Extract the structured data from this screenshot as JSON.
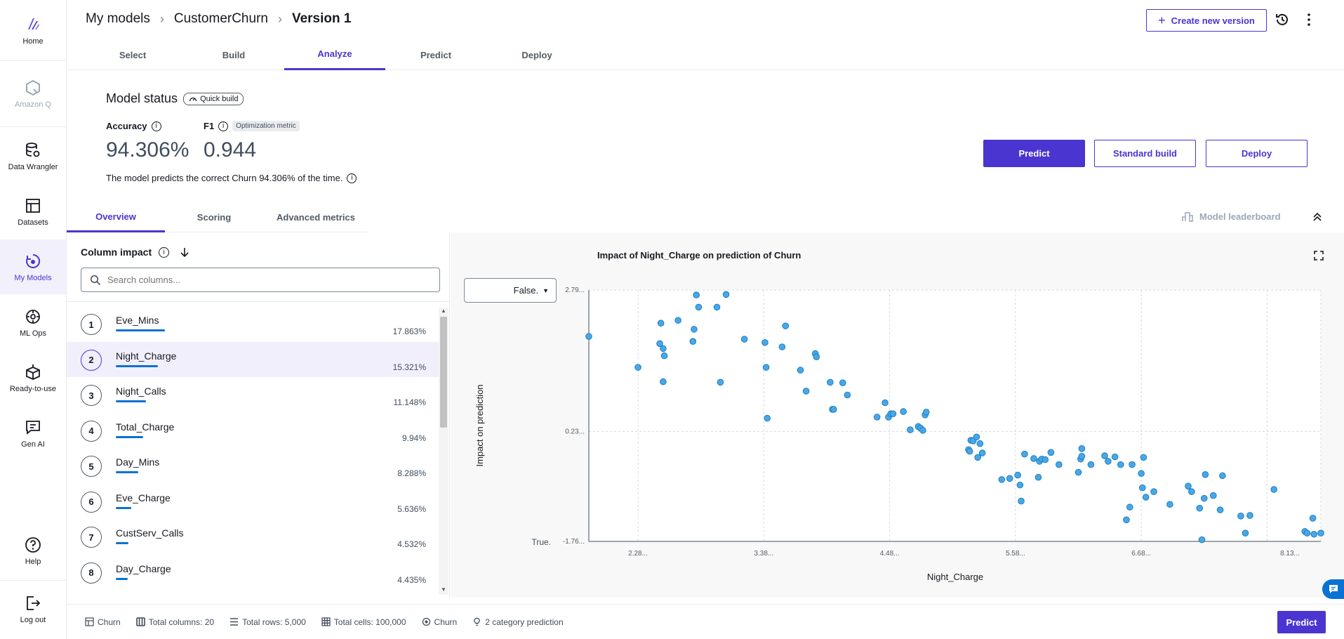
{
  "nav": {
    "home": "Home",
    "amazon_q": "Amazon Q",
    "data_wrangler": "Data Wrangler",
    "datasets": "Datasets",
    "my_models": "My Models",
    "ml_ops": "ML Ops",
    "ready_to_use": "Ready-to-use",
    "gen_ai": "Gen AI",
    "help": "Help",
    "log_out": "Log out"
  },
  "breadcrumb": {
    "root": "My models",
    "model": "CustomerChurn",
    "version": "Version 1"
  },
  "header": {
    "create_version": "Create new version"
  },
  "steps": [
    "Select",
    "Build",
    "Analyze",
    "Predict",
    "Deploy"
  ],
  "status": {
    "title": "Model status",
    "build_badge": "Quick build",
    "accuracy_label": "Accuracy",
    "accuracy_value": "94.306%",
    "f1_label": "F1",
    "f1_badge": "Optimization metric",
    "f1_value": "0.944",
    "description": "The model predicts the correct Churn 94.306% of the time."
  },
  "actions": {
    "predict": "Predict",
    "standard_build": "Standard build",
    "deploy": "Deploy"
  },
  "subtabs": [
    "Overview",
    "Scoring",
    "Advanced metrics"
  ],
  "leaderboard": "Model leaderboard",
  "column_impact": {
    "title": "Column impact",
    "search_placeholder": "Search columns...",
    "rows": [
      {
        "rank": "1",
        "name": "Eve_Mins",
        "pct": "17.863%",
        "share": 0.17863
      },
      {
        "rank": "2",
        "name": "Night_Charge",
        "pct": "15.321%",
        "share": 0.15321
      },
      {
        "rank": "3",
        "name": "Night_Calls",
        "pct": "11.148%",
        "share": 0.11148
      },
      {
        "rank": "4",
        "name": "Total_Charge",
        "pct": "9.94%",
        "share": 0.0994
      },
      {
        "rank": "5",
        "name": "Day_Mins",
        "pct": "8.288%",
        "share": 0.08288
      },
      {
        "rank": "6",
        "name": "Eve_Charge",
        "pct": "5.636%",
        "share": 0.05636
      },
      {
        "rank": "7",
        "name": "CustServ_Calls",
        "pct": "4.532%",
        "share": 0.04532
      },
      {
        "rank": "8",
        "name": "Day_Charge",
        "pct": "4.435%",
        "share": 0.04435
      }
    ]
  },
  "chart_select": {
    "value": "False."
  },
  "chart_data": {
    "type": "scatter",
    "title": "Impact of Night_Charge on prediction of Churn",
    "xlabel": "Night_Charge",
    "ylabel": "Impact on prediction",
    "x_ticks": [
      "2.28...",
      "3.38...",
      "4.48...",
      "5.58...",
      "6.68...",
      "8.13..."
    ],
    "y_ticks": [
      "2.79...",
      "0.23...",
      "-1.76..."
    ],
    "y_category_label": "True.",
    "xlim": [
      1.85,
      8.25
    ],
    "ylim": [
      -1.76,
      2.79
    ],
    "color": "#4aa7e6",
    "points": [
      [
        1.85,
        1.95
      ],
      [
        2.28,
        1.39
      ],
      [
        2.48,
        2.19
      ],
      [
        2.47,
        1.82
      ],
      [
        2.5,
        1.73
      ],
      [
        2.51,
        1.6
      ],
      [
        2.5,
        1.13
      ],
      [
        2.63,
        2.24
      ],
      [
        2.76,
        1.86
      ],
      [
        2.77,
        2.08
      ],
      [
        2.79,
        2.7
      ],
      [
        2.81,
        2.48
      ],
      [
        2.97,
        2.48
      ],
      [
        3.0,
        1.12
      ],
      [
        3.05,
        2.71
      ],
      [
        3.21,
        1.9
      ],
      [
        3.39,
        1.84
      ],
      [
        3.4,
        1.39
      ],
      [
        3.41,
        0.47
      ],
      [
        3.54,
        1.76
      ],
      [
        3.57,
        2.14
      ],
      [
        3.7,
        1.34
      ],
      [
        3.75,
        0.96
      ],
      [
        3.83,
        1.64
      ],
      [
        3.84,
        1.58
      ],
      [
        3.96,
        1.12
      ],
      [
        3.98,
        0.63
      ],
      [
        3.99,
        0.63
      ],
      [
        4.07,
        1.11
      ],
      [
        4.11,
        0.89
      ],
      [
        4.37,
        0.49
      ],
      [
        4.44,
        0.75
      ],
      [
        4.47,
        0.49
      ],
      [
        4.49,
        0.55
      ],
      [
        4.51,
        0.55
      ],
      [
        4.6,
        0.59
      ],
      [
        4.66,
        0.26
      ],
      [
        4.73,
        0.32
      ],
      [
        4.75,
        0.29
      ],
      [
        4.77,
        0.25
      ],
      [
        4.79,
        0.53
      ],
      [
        4.8,
        0.58
      ],
      [
        5.17,
        -0.1
      ],
      [
        5.18,
        -0.13
      ],
      [
        5.19,
        0.07
      ],
      [
        5.21,
        0.06
      ],
      [
        5.24,
        0.13
      ],
      [
        5.25,
        -0.24
      ],
      [
        5.27,
        0.01
      ],
      [
        5.29,
        -0.16
      ],
      [
        5.46,
        -0.64
      ],
      [
        5.53,
        -0.62
      ],
      [
        5.6,
        -0.56
      ],
      [
        5.62,
        -0.74
      ],
      [
        5.63,
        -1.03
      ],
      [
        5.66,
        -0.18
      ],
      [
        5.74,
        -0.26
      ],
      [
        5.78,
        -0.6
      ],
      [
        5.79,
        -0.31
      ],
      [
        5.81,
        -0.27
      ],
      [
        5.84,
        -0.28
      ],
      [
        5.89,
        -0.15
      ],
      [
        5.96,
        -0.37
      ],
      [
        6.13,
        -0.51
      ],
      [
        6.15,
        -0.27
      ],
      [
        6.16,
        -0.22
      ],
      [
        6.16,
        -0.08
      ],
      [
        6.24,
        -0.37
      ],
      [
        6.36,
        -0.21
      ],
      [
        6.39,
        -0.31
      ],
      [
        6.45,
        -0.23
      ],
      [
        6.5,
        -0.37
      ],
      [
        6.55,
        -1.37
      ],
      [
        6.58,
        -1.14
      ],
      [
        6.6,
        -0.37
      ],
      [
        6.68,
        -0.53
      ],
      [
        6.69,
        -0.79
      ],
      [
        6.7,
        -0.24
      ],
      [
        6.72,
        -0.96
      ],
      [
        6.79,
        -0.86
      ],
      [
        6.93,
        -1.09
      ],
      [
        7.09,
        -0.76
      ],
      [
        7.12,
        -0.86
      ],
      [
        7.19,
        -1.16
      ],
      [
        7.21,
        -1.73
      ],
      [
        7.23,
        -0.98
      ],
      [
        7.24,
        -0.55
      ],
      [
        7.31,
        -0.93
      ],
      [
        7.37,
        -1.19
      ],
      [
        7.39,
        -0.57
      ],
      [
        7.55,
        -1.3
      ],
      [
        7.59,
        -1.61
      ],
      [
        7.63,
        -1.29
      ],
      [
        7.84,
        -0.82
      ],
      [
        8.11,
        -1.58
      ],
      [
        8.13,
        -1.61
      ],
      [
        8.18,
        -1.34
      ],
      [
        8.19,
        -1.63
      ],
      [
        8.25,
        -1.61
      ]
    ]
  },
  "footer": {
    "target": "Churn",
    "total_columns": "Total columns: 20",
    "total_rows": "Total rows: 5,000",
    "total_cells": "Total cells: 100,000",
    "target2": "Churn",
    "prediction_type": "2 category prediction",
    "predict": "Predict"
  }
}
